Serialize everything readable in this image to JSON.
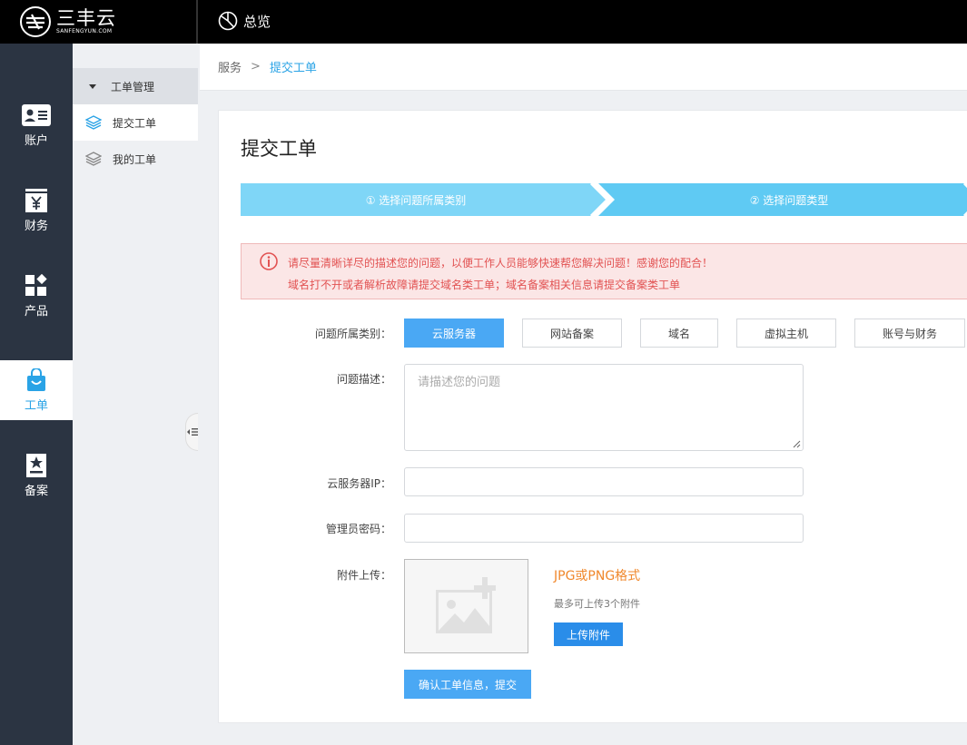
{
  "brand": {
    "name_cn": "三丰云",
    "name_en": "SANFENGYUN.COM"
  },
  "topnav": {
    "overview_label": "总览"
  },
  "sidebar": {
    "items": [
      {
        "label": "账户",
        "icon": "account-card-icon",
        "active": false
      },
      {
        "label": "财务",
        "icon": "finance-yen-icon",
        "active": false
      },
      {
        "label": "产品",
        "icon": "product-grid-icon",
        "active": false
      },
      {
        "label": "工单",
        "icon": "ticket-bag-icon",
        "active": true
      },
      {
        "label": "备案",
        "icon": "record-star-icon",
        "active": false
      }
    ]
  },
  "subnav": {
    "heading": "工单管理",
    "items": [
      {
        "label": "提交工单",
        "icon": "layers-icon",
        "active": true
      },
      {
        "label": "我的工单",
        "icon": "layers-icon",
        "active": false
      }
    ]
  },
  "breadcrumb": {
    "root": "服务",
    "separator": ">",
    "current": "提交工单"
  },
  "page": {
    "title": "提交工单"
  },
  "steps": [
    {
      "label": "① 选择问题所属类别",
      "active": true
    },
    {
      "label": "② 选择问题类型",
      "active": false
    }
  ],
  "alert": {
    "line1": "请尽量清晰详尽的描述您的问题，以便工作人员能够快速帮您解决问题！感谢您的配合！",
    "line2": "域名打不开或者解析故障请提交域名类工单；域名备案相关信息请提交备案类工单"
  },
  "form": {
    "category_label": "问题所属类别：",
    "categories": [
      "云服务器",
      "网站备案",
      "域名",
      "虚拟主机",
      "账号与财务"
    ],
    "selected_category": "云服务器",
    "description_label": "问题描述：",
    "description_placeholder": "请描述您的问题",
    "ip_label": "云服务器IP：",
    "password_label": "管理员密码：",
    "attachment_label": "附件上传：",
    "format_text": "JPG或PNG格式",
    "limit_text": "最多可上传3个附件",
    "upload_button": "上传附件",
    "submit_button": "确认工单信息，提交"
  },
  "colors": {
    "accent": "#2aa3e6",
    "step_active": "#7fd6f7",
    "step_next": "#5fcaf3",
    "alert_text": "#e25252",
    "format_text": "#f0882c",
    "sidebar_bg": "#2b3442"
  }
}
